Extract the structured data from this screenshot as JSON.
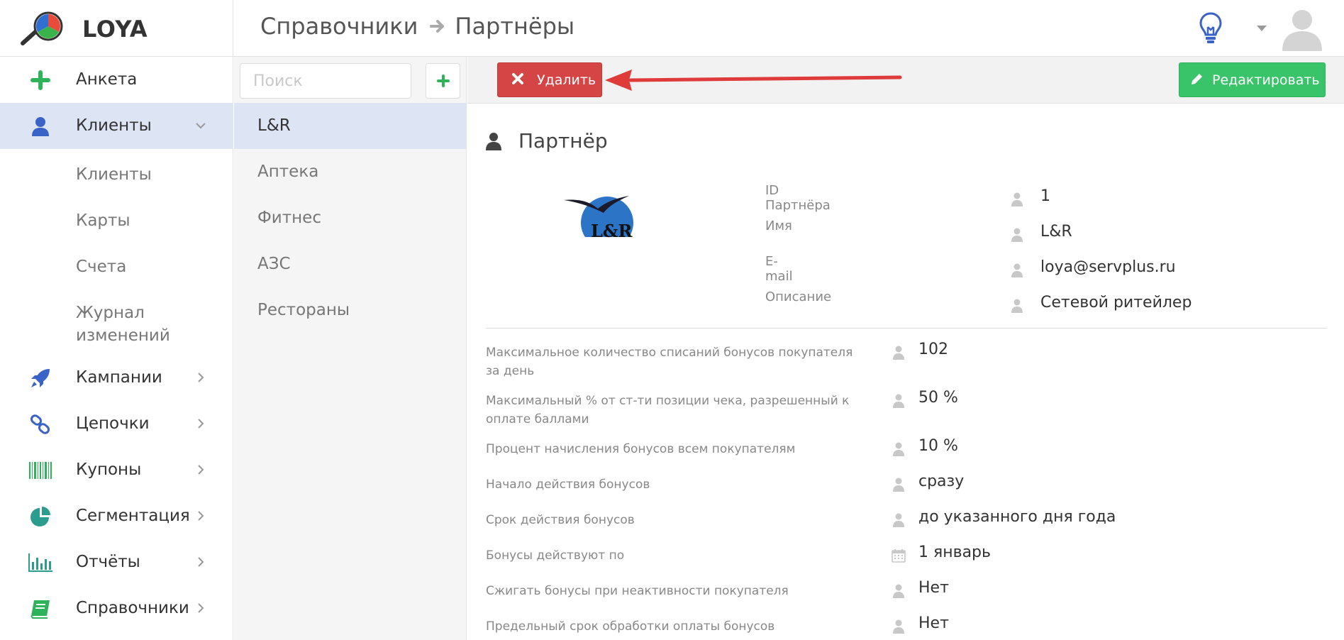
{
  "app": {
    "name": "LOYA"
  },
  "breadcrumb": [
    "Справочники",
    "Партнёры"
  ],
  "sidebar": {
    "items": [
      {
        "label": "Анкета"
      },
      {
        "label": "Клиенты",
        "expanded": true,
        "active": true
      },
      {
        "label": "Кампании"
      },
      {
        "label": "Цепочки"
      },
      {
        "label": "Купоны"
      },
      {
        "label": "Сегментация"
      },
      {
        "label": "Отчёты"
      },
      {
        "label": "Справочники"
      }
    ],
    "subitems": [
      {
        "label": "Клиенты"
      },
      {
        "label": "Карты"
      },
      {
        "label": "Счета"
      },
      {
        "label": "Журнал изменений"
      }
    ]
  },
  "list": {
    "search_placeholder": "Поиск",
    "items": [
      "L&R",
      "Аптека",
      "Фитнес",
      "АЗС",
      "Рестораны"
    ],
    "selected": "L&R"
  },
  "toolbar": {
    "delete_label": "Удалить",
    "edit_label": "Редактировать"
  },
  "partner": {
    "section_title": "Партнёр",
    "logo_text": "L&R",
    "fields": [
      {
        "label": "ID Партнёра",
        "value": "1"
      },
      {
        "label": "Имя",
        "value": "L&R"
      },
      {
        "label": "E-mail",
        "value": "loya@servplus.ru"
      },
      {
        "label": "Описание",
        "value": "Сетевой ритейлер"
      }
    ],
    "settings": [
      {
        "label": "Максимальное количество списаний бонусов покупателя за день",
        "value": "102",
        "icon": "user-icon"
      },
      {
        "label": "Максимальный % от ст-ти позиции чека, разрешенный к оплате баллами",
        "value": "50 %",
        "icon": "user-icon"
      },
      {
        "label": "Процент начисления бонусов всем покупателям",
        "value": "10 %",
        "icon": "user-icon"
      },
      {
        "label": "Начало действия бонусов",
        "value": "сразу",
        "icon": "user-icon"
      },
      {
        "label": "Срок действия бонусов",
        "value": "до указанного дня года",
        "icon": "user-icon"
      },
      {
        "label": "Бонусы действуют по",
        "value": "1 январь",
        "icon": "calendar-icon"
      },
      {
        "label": "Сжигать бонусы при неактивности покупателя",
        "value": "Нет",
        "icon": "user-icon"
      },
      {
        "label": "Предельный срок обработки оплаты бонусов",
        "value": "Нет",
        "icon": "user-icon"
      }
    ]
  },
  "colors": {
    "accent_green": "#39c46a",
    "danger_red": "#d64545",
    "active_bg": "#dde4f4",
    "nav_blue": "#3a63c8"
  }
}
